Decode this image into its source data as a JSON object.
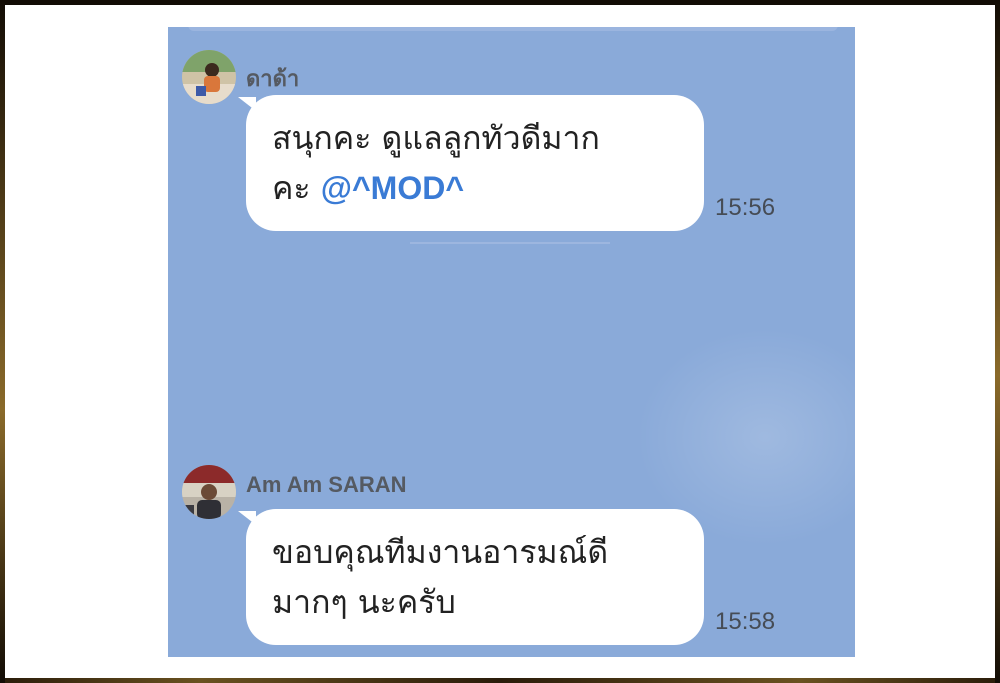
{
  "chat": {
    "background_color": "#8aaad9",
    "messages": [
      {
        "sender": "ดาด้า",
        "avatar_icon": "profile-photo",
        "line1": "สนุกคะ ดูแลลูกทัวดีมาก",
        "line2_prefix": "คะ ",
        "mention": "@^MOD^",
        "time": "15:56"
      },
      {
        "sender": "Am Am SARAN",
        "avatar_icon": "profile-photo",
        "line1": "ขอบคุณทีมงานอารมณ์ดี",
        "line2": "มากๆ นะครับ",
        "time": "15:58"
      }
    ]
  }
}
